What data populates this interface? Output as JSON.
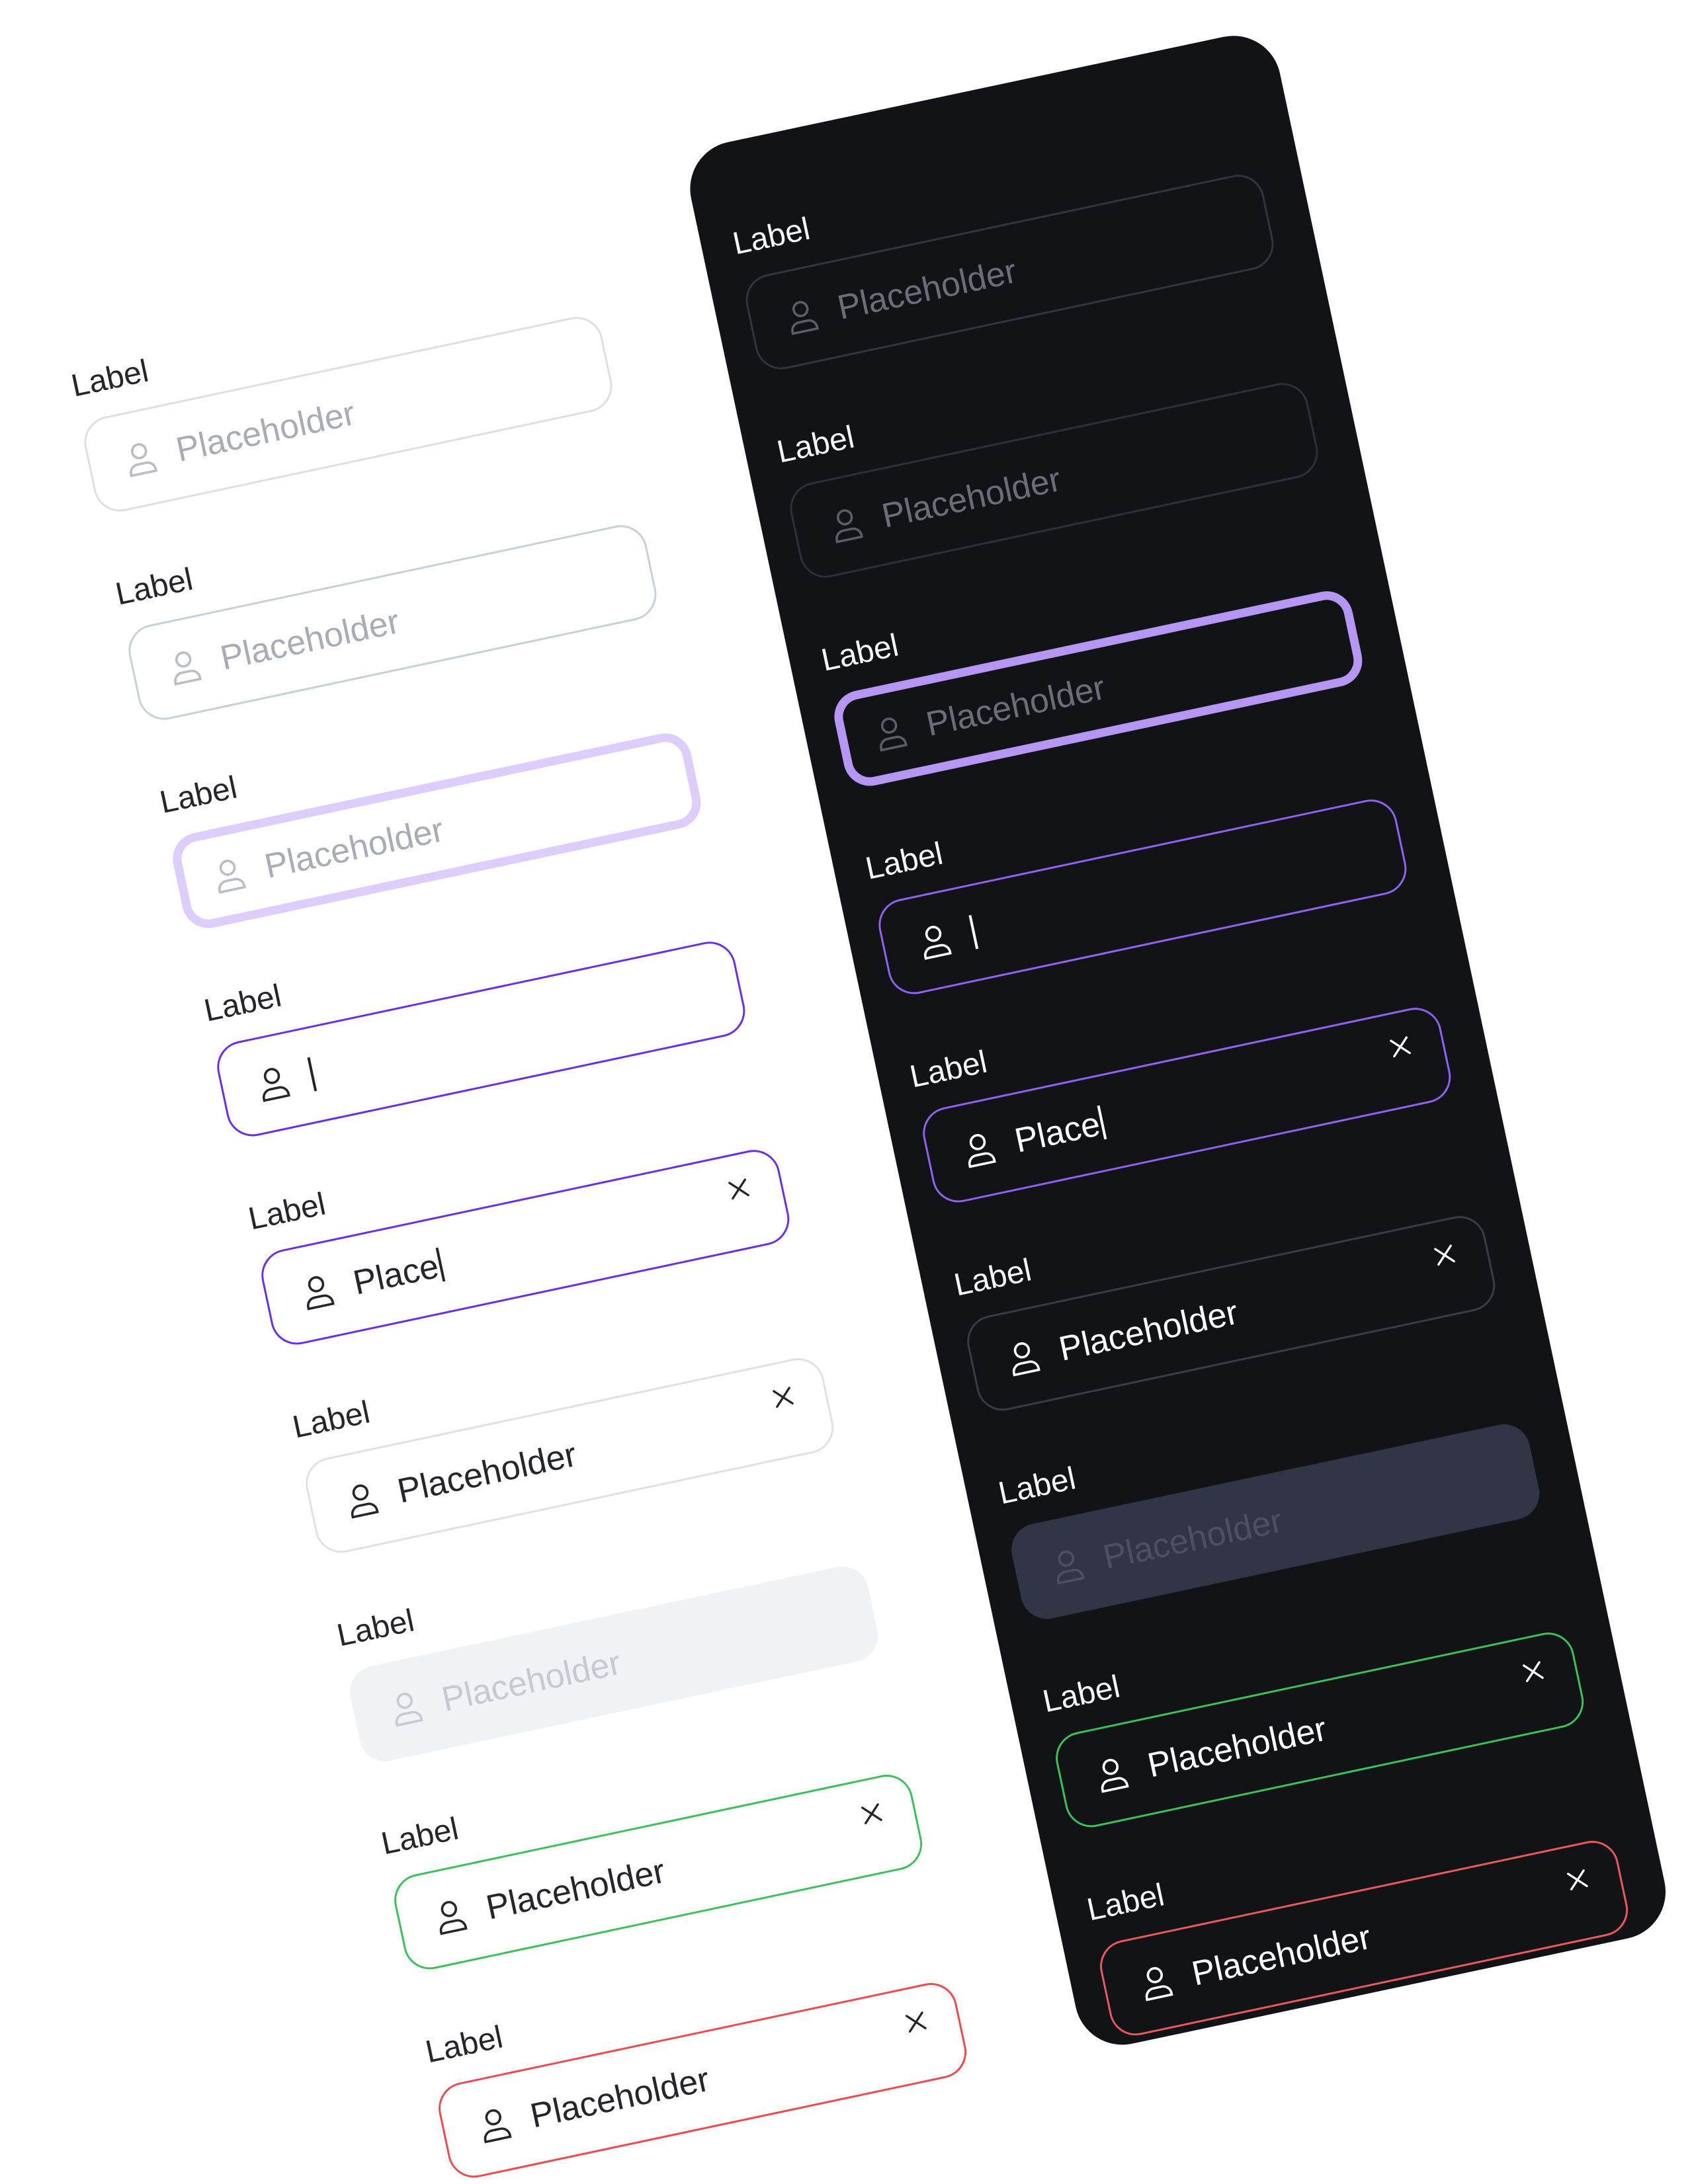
{
  "themes": {
    "light": {
      "background": "#ffffff",
      "text": "#24262c",
      "placeholder": "#a8acb4",
      "accent": "#6a2ee6",
      "focus_ring": "#dccdfb",
      "disabled_bg": "#f0f3f6"
    },
    "dark": {
      "background": "#121316",
      "text": "#f4f5f7",
      "placeholder": "#6b6e78",
      "accent": "#8f63f0",
      "focus_ring": "#b596f2",
      "disabled_bg": "#323545"
    }
  },
  "status_colors": {
    "success": "#3cc05a",
    "error": "#ec4a4e"
  },
  "icons": {
    "leading": "user-icon",
    "trailing": "close-icon"
  },
  "light_fields": [
    {
      "state": "default",
      "label": "Label",
      "placeholder": "Placeholder",
      "value": ""
    },
    {
      "state": "hover",
      "label": "Label",
      "placeholder": "Placeholder",
      "value": ""
    },
    {
      "state": "focus",
      "label": "Label",
      "placeholder": "Placeholder",
      "value": ""
    },
    {
      "state": "typing",
      "label": "Label",
      "placeholder": "",
      "value": ""
    },
    {
      "state": "typing",
      "label": "Label",
      "placeholder": "",
      "value": "Place"
    },
    {
      "state": "filled",
      "label": "Label",
      "placeholder": "",
      "value": "Placeholder"
    },
    {
      "state": "disabled",
      "label": "Label",
      "placeholder": "Placeholder",
      "value": ""
    },
    {
      "state": "success",
      "label": "Label",
      "placeholder": "",
      "value": "Placeholder"
    },
    {
      "state": "error",
      "label": "Label",
      "placeholder": "",
      "value": "Placeholder"
    }
  ],
  "dark_fields": [
    {
      "state": "default",
      "label": "Label",
      "placeholder": "Placeholder",
      "value": ""
    },
    {
      "state": "hover",
      "label": "Label",
      "placeholder": "Placeholder",
      "value": ""
    },
    {
      "state": "focus",
      "label": "Label",
      "placeholder": "Placeholder",
      "value": ""
    },
    {
      "state": "typing",
      "label": "Label",
      "placeholder": "",
      "value": ""
    },
    {
      "state": "typing",
      "label": "Label",
      "placeholder": "",
      "value": "Place"
    },
    {
      "state": "filled",
      "label": "Label",
      "placeholder": "",
      "value": "Placeholder"
    },
    {
      "state": "disabled",
      "label": "Label",
      "placeholder": "Placeholder",
      "value": ""
    },
    {
      "state": "success",
      "label": "Label",
      "placeholder": "",
      "value": "Placeholder"
    },
    {
      "state": "error",
      "label": "Label",
      "placeholder": "",
      "value": "Placeholder"
    }
  ]
}
